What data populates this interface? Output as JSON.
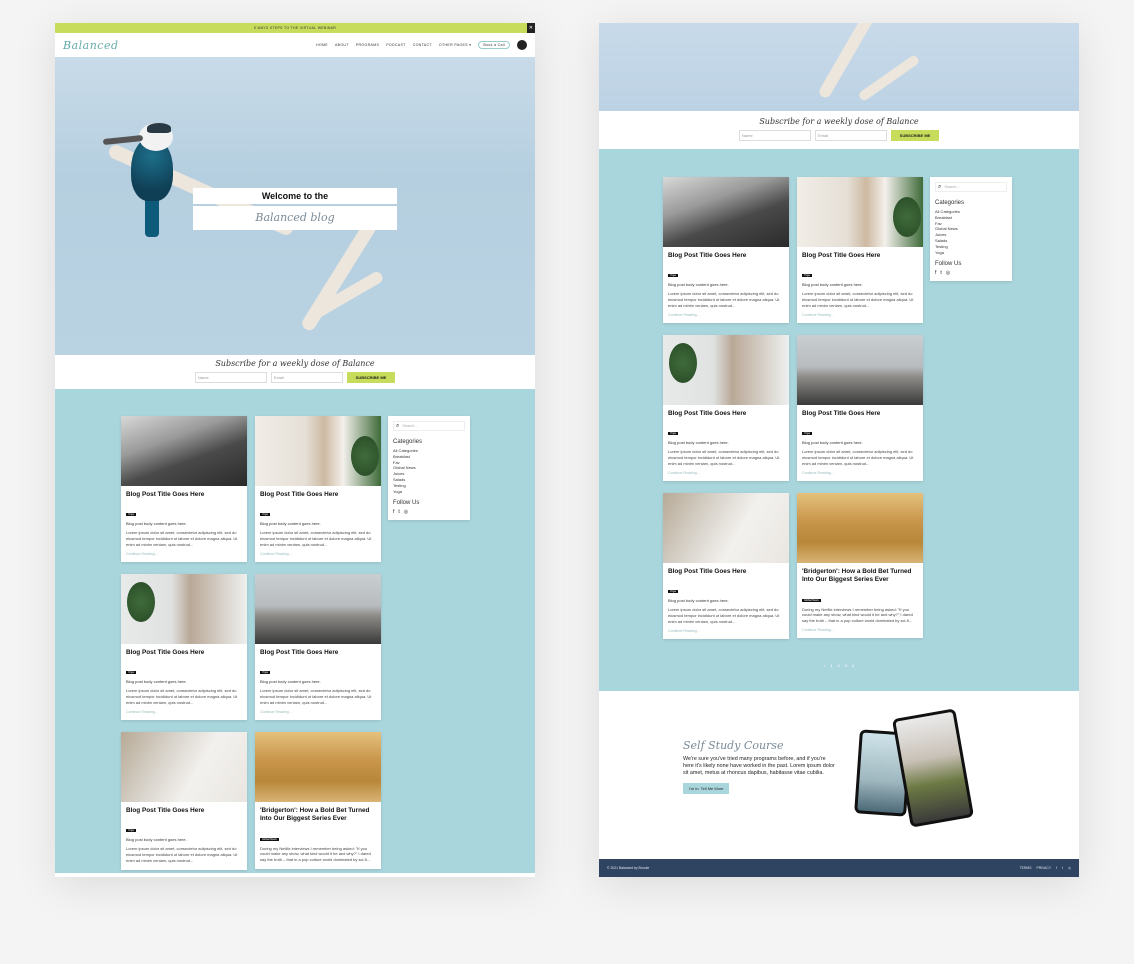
{
  "promo": "5 WAYS STEPS TO THE VIRTUAL WEBINAR",
  "nav": {
    "logo": "Balanced",
    "links": [
      "HOME",
      "ABOUT",
      "PROGRAMS",
      "PODCAST",
      "CONTACT",
      "OTHER PAGES"
    ],
    "button": "Book a Call"
  },
  "hero": {
    "title": "Welcome to the",
    "script": "Balanced blog"
  },
  "subscribe": {
    "title": "Subscribe for a weekly dose of Balance",
    "name_placeholder": "Name",
    "email_placeholder": "Email",
    "button": "SUBSCRIBE ME"
  },
  "posts": [
    {
      "title": "Blog Post Title Goes Here",
      "tag": "Yoga",
      "sub": "Blog post body content goes here.",
      "text": "Lorem ipsum dolor sit amet, consectetur adipiscing elit, sed do eiusmod tempor incididunt ut labore et dolore magna aliqua. Ut enim ad minim veniam, quis nostrud...",
      "link": "Continue Reading..."
    },
    {
      "title": "Blog Post Title Goes Here",
      "tag": "Yoga",
      "sub": "Blog post body content goes here.",
      "text": "Lorem ipsum dolor sit amet, consectetur adipiscing elit, sed do eiusmod tempor incididunt ut labore et dolore magna aliqua. Ut enim ad minim veniam, quis nostrud...",
      "link": "Continue Reading..."
    },
    {
      "title": "Blog Post Title Goes Here",
      "tag": "Yoga",
      "sub": "Blog post body content goes here.",
      "text": "Lorem ipsum dolor sit amet, consectetur adipiscing elit, sed do eiusmod tempor incididunt ut labore et dolore magna aliqua. Ut enim ad minim veniam, quis nostrud...",
      "link": "Continue Reading..."
    },
    {
      "title": "Blog Post Title Goes Here",
      "tag": "Yoga",
      "sub": "Blog post body content goes here.",
      "text": "Lorem ipsum dolor sit amet, consectetur adipiscing elit, sed do eiusmod tempor incididunt ut labore et dolore magna aliqua. Ut enim ad minim veniam, quis nostrud...",
      "link": "Continue Reading..."
    },
    {
      "title": "Blog Post Title Goes Here",
      "tag": "Yoga",
      "sub": "Blog post body content goes here.",
      "text": "Lorem ipsum dolor sit amet, consectetur adipiscing elit, sed do eiusmod tempor incididunt ut labore et dolore magna aliqua. Ut enim ad minim veniam, quis nostrud...",
      "link": "Continue Reading..."
    },
    {
      "title": "'Bridgerton': How a Bold Bet Turned Into Our Biggest Series Ever",
      "tag": "Global News",
      "sub": "During my Netflix interviews I remember being asked: \"If you could make any show, what kind would it be and why?\" I dared say the truth – that in a pop culture world dominated by sci-fi...",
      "text": "",
      "link": "Continue Reading..."
    }
  ],
  "sidebar": {
    "search_placeholder": "Search...",
    "categories_title": "Categories",
    "categories": [
      "All Categories",
      "Breakfast",
      "Fav",
      "Global News",
      "Juices",
      "Salads",
      "Testing",
      "Yoga"
    ],
    "follow_title": "Follow Us"
  },
  "pager": [
    "1",
    "2",
    "3",
    "4"
  ],
  "course": {
    "title": "Self Study Course",
    "text": "We're sure you've tried many programs before, and if you're here it's likely none have worked in the past. Lorem ipsum dolor sit amet, metus at rhoncus dapibus, habitasse vitae cubilia.",
    "button": "I'm in. Tell Me More"
  },
  "footer": {
    "copyright": "© 2021 Balanced by Brooke",
    "links": [
      "TERMS",
      "PRIVACY"
    ]
  }
}
